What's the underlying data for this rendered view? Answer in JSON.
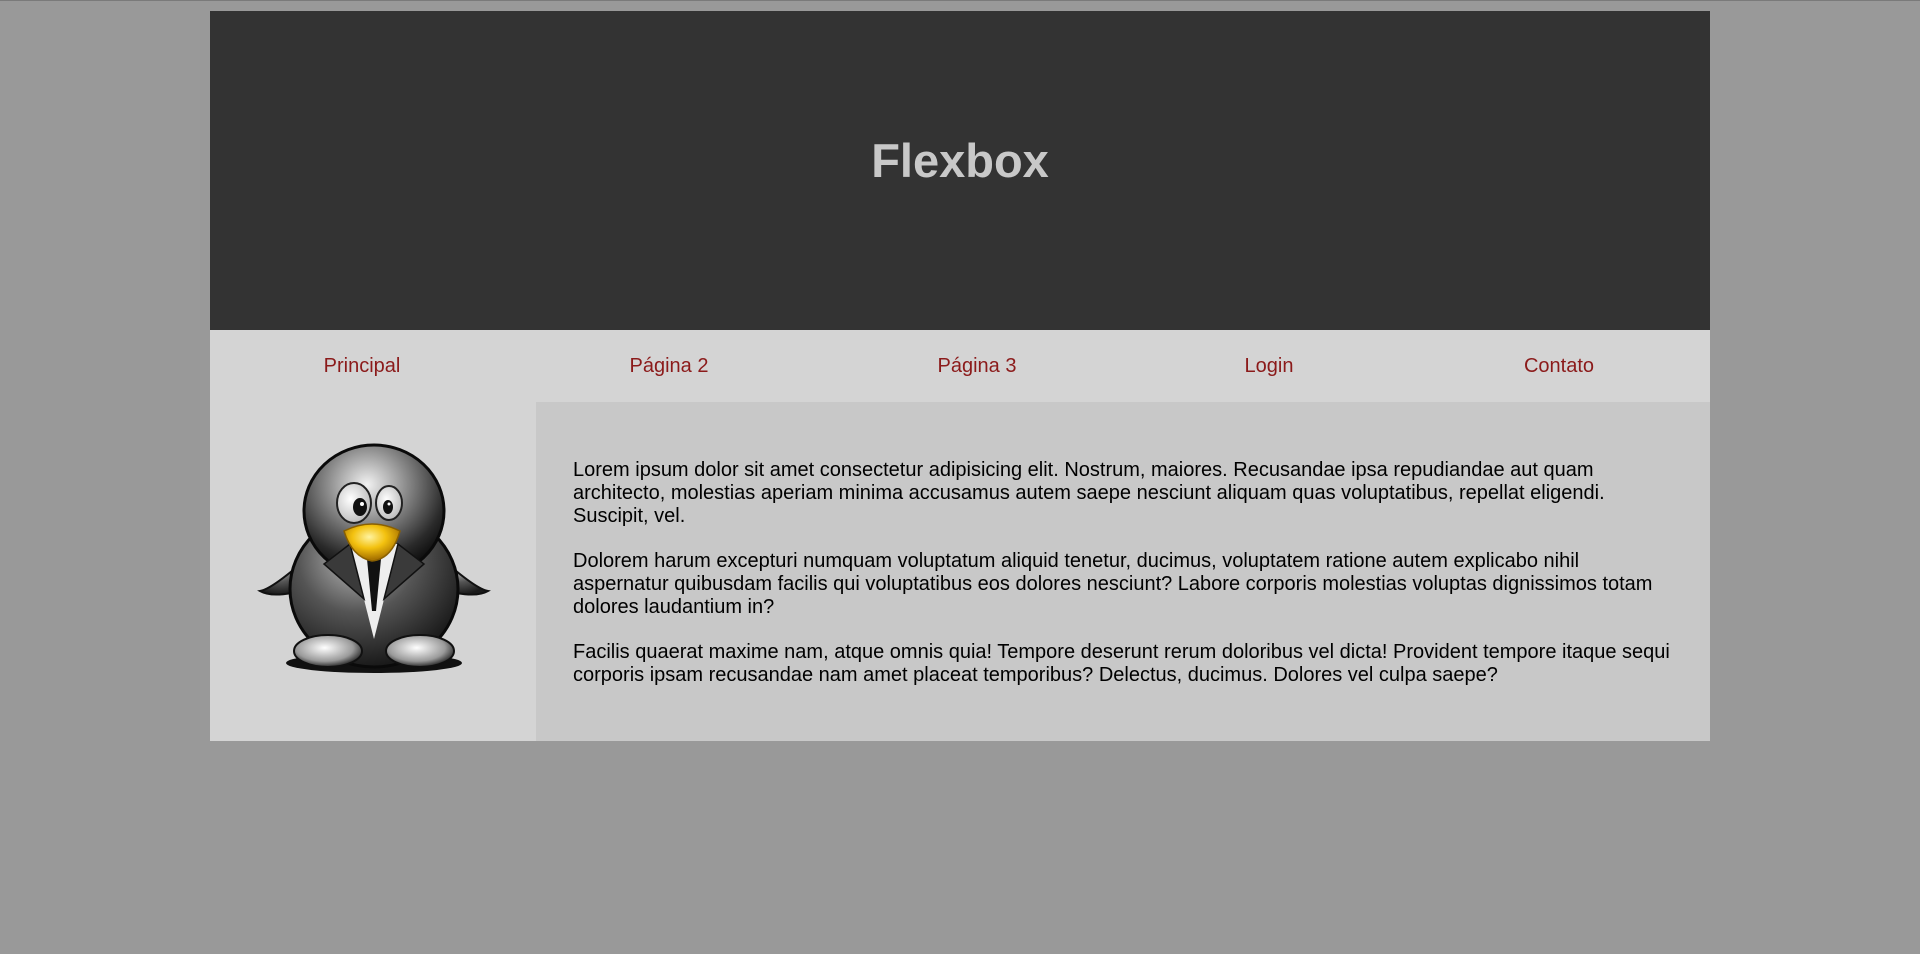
{
  "header": {
    "title": "Flexbox"
  },
  "nav": {
    "items": [
      {
        "label": "Principal"
      },
      {
        "label": "Página 2"
      },
      {
        "label": "Página 3"
      },
      {
        "label": "Login"
      },
      {
        "label": "Contato"
      }
    ]
  },
  "sidebar": {
    "image_icon": "penguin-in-suit-icon"
  },
  "content": {
    "paragraphs": [
      "Lorem ipsum dolor sit amet consectetur adipisicing elit. Nostrum, maiores. Recusandae ipsa repudiandae aut quam architecto, molestias aperiam minima accusamus autem saepe nesciunt aliquam quas voluptatibus, repellat eligendi. Suscipit, vel.",
      "Dolorem harum excepturi numquam voluptatum aliquid tenetur, ducimus, voluptatem ratione autem explicabo nihil aspernatur quibusdam facilis qui voluptatibus eos dolores nesciunt? Labore corporis molestias voluptas dignissimos totam dolores laudantium in?",
      "Facilis quaerat maxime nam, atque omnis quia! Tempore deserunt rerum doloribus vel dicta! Provident tempore itaque sequi corporis ipsam recusandae nam amet placeat temporibus? Delectus, ducimus. Dolores vel culpa saepe?"
    ]
  },
  "colors": {
    "page_background": "#999999",
    "header_background": "#333333",
    "header_text": "#c8c8c8",
    "nav_background": "#d4d4d4",
    "nav_link": "#8b1a1a",
    "content_background": "#c8c8c8"
  }
}
